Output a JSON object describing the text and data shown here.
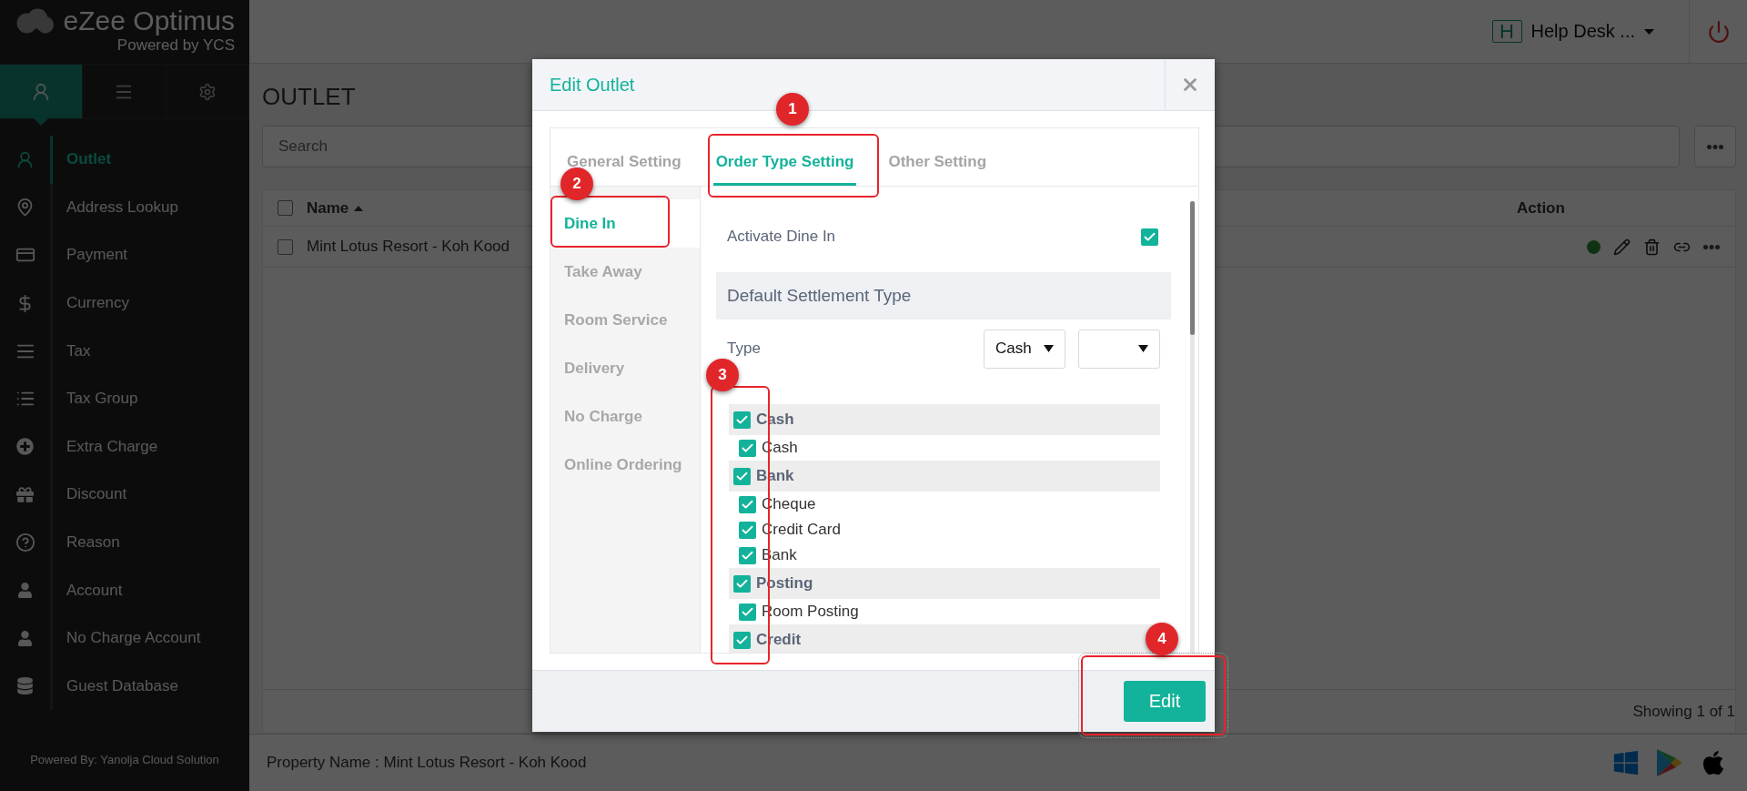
{
  "brand": {
    "name": "eZee Optimus",
    "tagline": "Powered by YCS"
  },
  "sidebar": {
    "tabs": [
      {
        "selected": true
      },
      {
        "selected": false
      },
      {
        "selected": false
      }
    ],
    "items": [
      {
        "label": "Outlet",
        "selected": true
      },
      {
        "label": "Address Lookup",
        "selected": false
      },
      {
        "label": "Payment",
        "selected": false
      },
      {
        "label": "Currency",
        "selected": false
      },
      {
        "label": "Tax",
        "selected": false
      },
      {
        "label": "Tax Group",
        "selected": false
      },
      {
        "label": "Extra Charge",
        "selected": false
      },
      {
        "label": "Discount",
        "selected": false
      },
      {
        "label": "Reason",
        "selected": false
      },
      {
        "label": "Account",
        "selected": false
      },
      {
        "label": "No Charge Account",
        "selected": false
      },
      {
        "label": "Guest Database",
        "selected": false
      }
    ],
    "credit": "Powered By: Yanolja Cloud Solution"
  },
  "header": {
    "user_initial": "H",
    "user_name": "Help Desk ..."
  },
  "page": {
    "title": "OUTLET",
    "search": {
      "placeholder": "Search"
    },
    "table": {
      "header_checked": false,
      "columns": [
        {
          "label": "Name",
          "sorted": true
        },
        {
          "label": "Action"
        }
      ],
      "rows": [
        {
          "checked": false,
          "name": "Mint Lotus Resort - Koh Kood",
          "active": true
        }
      ]
    },
    "pager": "Showing 1 of 1"
  },
  "footer": {
    "property": "Property Name : Mint Lotus Resort - Koh Kood"
  },
  "modal": {
    "title": "Edit Outlet",
    "tabs": [
      {
        "label": "General Setting",
        "selected": false
      },
      {
        "label": "Order Type Setting",
        "selected": true
      },
      {
        "label": "Other Setting",
        "selected": false
      }
    ],
    "order_types": [
      {
        "label": "Dine In",
        "selected": true
      },
      {
        "label": "Take Away",
        "selected": false
      },
      {
        "label": "Room Service",
        "selected": false
      },
      {
        "label": "Delivery",
        "selected": false
      },
      {
        "label": "No Charge",
        "selected": false
      },
      {
        "label": "Online Ordering",
        "selected": false
      }
    ],
    "activate": {
      "label": "Activate Dine In",
      "checked": true
    },
    "section": "Default Settlement Type",
    "type": {
      "label": "Type",
      "value": "Cash"
    },
    "settlements": [
      {
        "label": "Cash",
        "checked": true,
        "children": [
          {
            "label": "Cash",
            "checked": true
          }
        ]
      },
      {
        "label": "Bank",
        "checked": true,
        "children": [
          {
            "label": "Cheque",
            "checked": true
          },
          {
            "label": "Credit Card",
            "checked": true
          },
          {
            "label": "Bank",
            "checked": true
          }
        ]
      },
      {
        "label": "Posting",
        "checked": true,
        "children": [
          {
            "label": "Room Posting",
            "checked": true
          }
        ]
      },
      {
        "label": "Credit",
        "checked": true
      }
    ],
    "button": "Edit"
  },
  "annotations": [
    {
      "number": "1"
    },
    {
      "number": "2"
    },
    {
      "number": "3"
    },
    {
      "number": "4"
    }
  ]
}
